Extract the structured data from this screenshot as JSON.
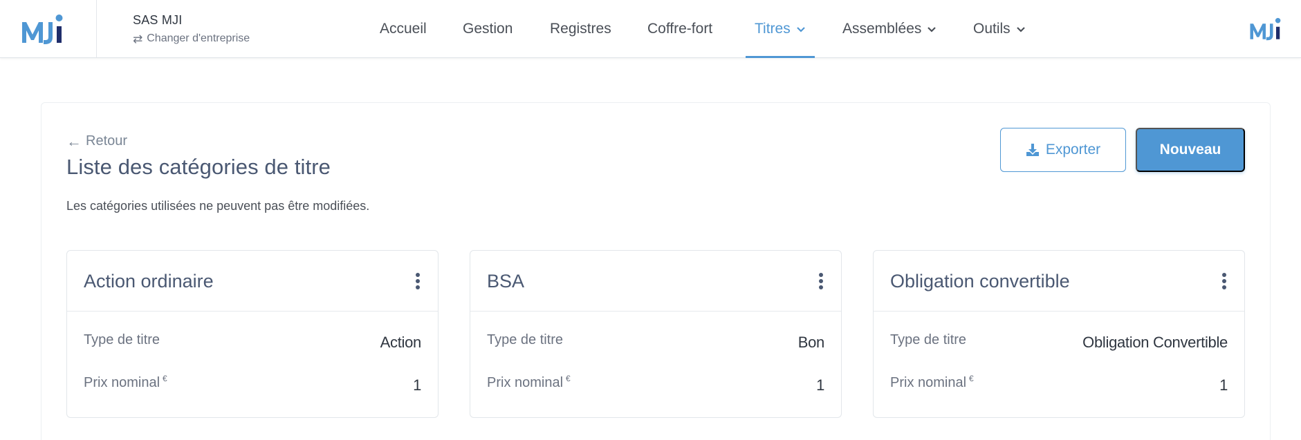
{
  "brand": {
    "logo_text": "MJi",
    "accent": "#4f97d4",
    "dark": "#1f2d6b"
  },
  "company": {
    "name": "SAS MJI",
    "switch_label": "Changer d'entreprise",
    "switch_icon": "swap-arrows-icon"
  },
  "nav": [
    {
      "label": "Accueil",
      "active": false,
      "dropdown": false
    },
    {
      "label": "Gestion",
      "active": false,
      "dropdown": false
    },
    {
      "label": "Registres",
      "active": false,
      "dropdown": false
    },
    {
      "label": "Coffre-fort",
      "active": false,
      "dropdown": false
    },
    {
      "label": "Titres",
      "active": true,
      "dropdown": true
    },
    {
      "label": "Assemblées",
      "active": false,
      "dropdown": true
    },
    {
      "label": "Outils",
      "active": false,
      "dropdown": true
    }
  ],
  "page": {
    "back_label": "Retour",
    "title": "Liste des catégories de titre",
    "subtitle": "Les catégories utilisées ne peuvent pas être modifiées.",
    "export_label": "Exporter",
    "new_label": "Nouveau"
  },
  "cards": [
    {
      "title": "Action ordinaire",
      "type_label": "Type de titre",
      "type_value": "Action",
      "price_label": "Prix nominal",
      "price_unit": "€",
      "price_value": "1"
    },
    {
      "title": "BSA",
      "type_label": "Type de titre",
      "type_value": "Bon",
      "price_label": "Prix nominal",
      "price_unit": "€",
      "price_value": "1"
    },
    {
      "title": "Obligation convertible",
      "type_label": "Type de titre",
      "type_value": "Obligation Convertible",
      "price_label": "Prix nominal",
      "price_unit": "€",
      "price_value": "1"
    }
  ]
}
